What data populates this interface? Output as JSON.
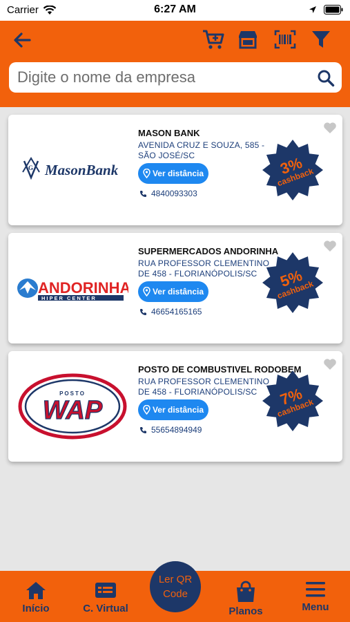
{
  "status_bar": {
    "carrier": "Carrier",
    "time": "6:27 AM"
  },
  "search": {
    "placeholder": "Digite o nome da empresa"
  },
  "colors": {
    "brand_orange": "#f2610c",
    "navy": "#1d3768",
    "button_blue": "#1e88f0"
  },
  "header": {
    "icons": [
      "back-arrow-icon",
      "add-cart-icon",
      "store-icon",
      "barcode-icon",
      "filter-icon"
    ]
  },
  "stores": [
    {
      "name": "MASON BANK",
      "address": "AVENIDA CRUZ E SOUZA, 585 - SÃO JOSÉ/SC",
      "distance_label": "Ver distância",
      "phone": "4840093303",
      "cashback_percent": "3%",
      "cashback_label": "cashback",
      "logo_text": "MasonBank"
    },
    {
      "name": "SUPERMERCADOS ANDORINHA",
      "address": "RUA PROFESSOR CLEMENTINO DE 458 - FLORIANÓPOLIS/SC",
      "distance_label": "Ver distância",
      "phone": "46654165165",
      "cashback_percent": "5%",
      "cashback_label": "cashback",
      "logo_text": "ANDORINHA",
      "logo_subtext": "HIPER CENTER"
    },
    {
      "name": "POSTO DE COMBUSTIVEL RODOBEM",
      "address": "RUA PROFESSOR CLEMENTINO DE 458 - FLORIANÓPOLIS/SC",
      "distance_label": "Ver distância",
      "phone": "55654894949",
      "cashback_percent": "7%",
      "cashback_label": "cashback",
      "logo_text": "WAP",
      "logo_subtext": "POSTO"
    }
  ],
  "bottom_nav": {
    "inicio": "Início",
    "c_virtual": "C. Virtual",
    "qr": "Ler QR Code",
    "planos": "Planos",
    "menu": "Menu"
  }
}
